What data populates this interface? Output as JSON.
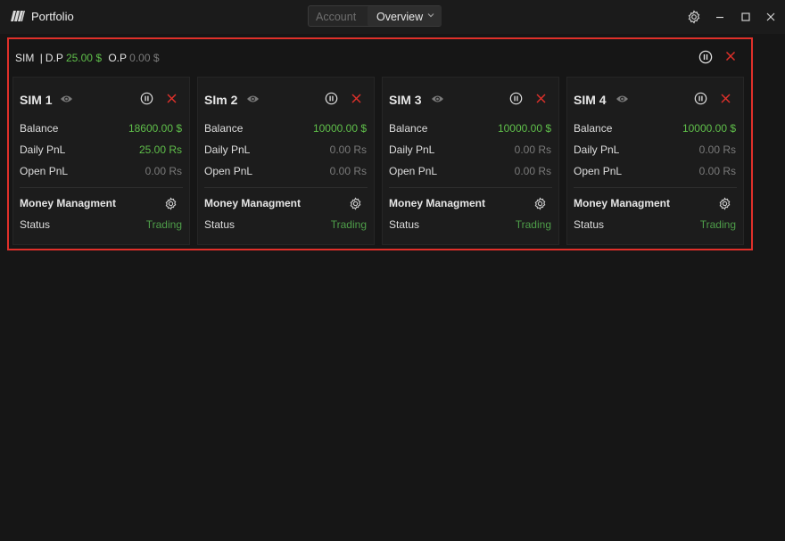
{
  "app": {
    "title": "Portfolio"
  },
  "mode_switch": {
    "account_label": "Account",
    "overview_label": "Overview"
  },
  "group": {
    "name": "SIM",
    "separator": "|",
    "dp_label": "D.P",
    "dp_value": "25.00 $",
    "op_label": "O.P",
    "op_value": "0.00 $"
  },
  "cards": [
    {
      "title": "SIM 1",
      "balance_label": "Balance",
      "balance": "18600.00 $",
      "daily_label": "Daily PnL",
      "daily": "25.00 Rs",
      "open_label": "Open PnL",
      "open": "0.00 Rs",
      "mm_label": "Money Managment",
      "status_label": "Status",
      "status": "Trading"
    },
    {
      "title": "SIm 2",
      "balance_label": "Balance",
      "balance": "10000.00 $",
      "daily_label": "Daily PnL",
      "daily": "0.00 Rs",
      "open_label": "Open PnL",
      "open": "0.00 Rs",
      "mm_label": "Money Managment",
      "status_label": "Status",
      "status": "Trading"
    },
    {
      "title": "SIM 3",
      "balance_label": "Balance",
      "balance": "10000.00 $",
      "daily_label": "Daily PnL",
      "daily": "0.00 Rs",
      "open_label": "Open PnL",
      "open": "0.00 Rs",
      "mm_label": "Money Managment",
      "status_label": "Status",
      "status": "Trading"
    },
    {
      "title": "SIM 4",
      "balance_label": "Balance",
      "balance": "10000.00 $",
      "daily_label": "Daily PnL",
      "daily": "0.00 Rs",
      "open_label": "Open PnL",
      "open": "0.00 Rs",
      "mm_label": "Money Managment",
      "status_label": "Status",
      "status": "Trading"
    }
  ],
  "icons": [
    "logo-icon",
    "chevron-down-icon",
    "gear-icon",
    "minimize-icon",
    "maximize-icon",
    "close-icon",
    "pause-icon",
    "eye-icon"
  ],
  "colors": {
    "accent_red": "#e0302a",
    "positive_green": "#5fbf4a",
    "status_green": "#4e9e49",
    "muted_grey": "#7a7a7a",
    "background": "#161616"
  }
}
